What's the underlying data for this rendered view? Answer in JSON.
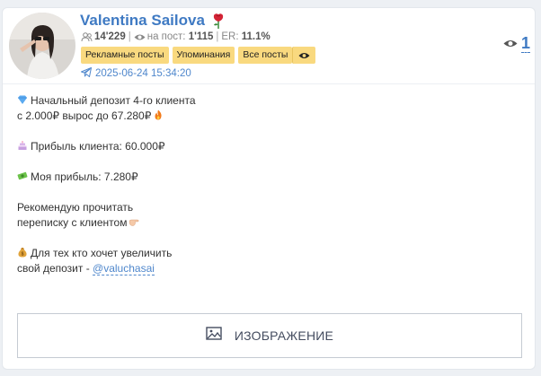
{
  "channel": {
    "name": "Valentina Sailova",
    "subscribers": "14'229",
    "reach_label": "на пост:",
    "reach_value": "1'115",
    "er_label": "ER:",
    "er_value": "11.1%"
  },
  "buttons": {
    "ads": "Рекламные посты",
    "mentions": "Упоминания",
    "all_posts": "Все посты"
  },
  "post": {
    "date": "2025-06-24 15:34:20",
    "views": "1",
    "lines": {
      "l1": "Начальный депозит 4-го клиента",
      "l2": "с 2.000₽ вырос до 67.280₽",
      "l3": "Прибыль клиента: 60.000₽",
      "l4": "Моя прибыль: 7.280₽",
      "l5": "Рекомендую прочитать",
      "l6": "переписку с клиентом",
      "l7": "Для тех кто хочет увеличить",
      "l8": "свой депозит - ",
      "mention": "@valuchasai"
    },
    "media_label": "ИЗОБРАЖЕНИЕ"
  },
  "icons": {
    "rose": "rose-icon",
    "subscribers": "people-icon",
    "views": "eye-icon",
    "telegram": "telegram-icon",
    "image": "image-icon"
  },
  "colors": {
    "accent": "#3f7ac3",
    "button_bg": "#f9d97f",
    "background": "#edf0f4"
  }
}
